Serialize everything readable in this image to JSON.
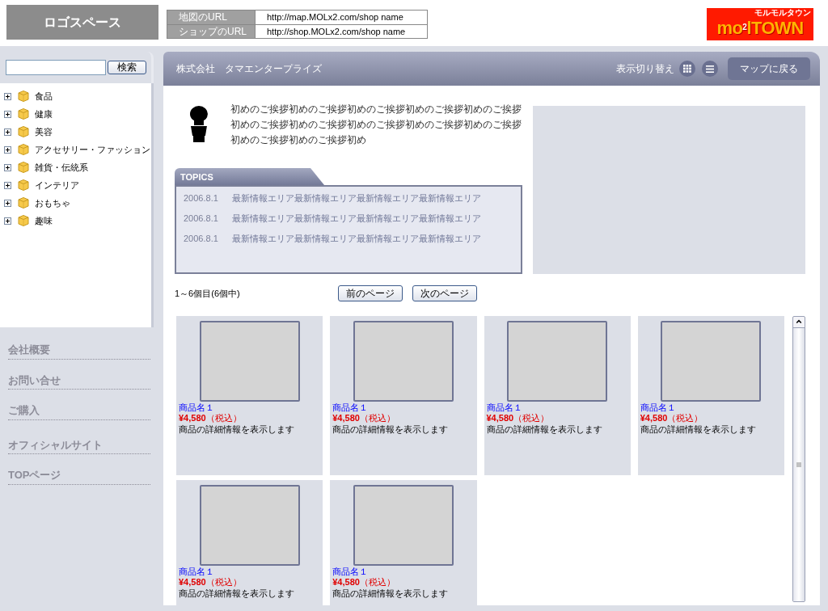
{
  "header": {
    "logo_space": "ロゴスペース",
    "urls": [
      {
        "label": "地図のURL",
        "value": "http://map.MOLx2.com/shop name"
      },
      {
        "label": "ショップのURL",
        "value": "http://shop.MOLx2.com/shop name"
      }
    ],
    "brand": {
      "name_start": "mo",
      "name_mid": "l",
      "name_end": "TOWN",
      "superscript": "2",
      "tagline": "モルモルタウン"
    }
  },
  "sidebar": {
    "search": {
      "button": "検索"
    },
    "categories": [
      {
        "label": "食品",
        "expanded": false
      },
      {
        "label": "健康",
        "expanded": false
      },
      {
        "label": "美容",
        "expanded": false
      },
      {
        "label": "アクセサリー・ファッション",
        "expanded": false
      },
      {
        "label": "雑貨・伝統系",
        "expanded": false
      },
      {
        "label": "インテリア",
        "expanded": false
      },
      {
        "label": "おもちゃ",
        "expanded": false
      },
      {
        "label": "趣味",
        "expanded": false
      }
    ],
    "links": [
      "会社概要",
      "お問い合せ",
      "ご購入",
      "オフィシャルサイト",
      "TOPページ"
    ]
  },
  "main": {
    "company": "株式会社　タマエンタープライズ",
    "view_toggle_label": "表示切り替え",
    "back_button": "マップに戻る",
    "greeting": "初めのご挨拶初めのご挨拶初めのご挨拶初めのご挨拶初めのご挨拶初めのご挨拶初めのご挨拶初めのご挨拶初めのご挨拶初めのご挨拶初めのご挨拶初めのご挨拶初め",
    "topics": {
      "title": "TOPICS",
      "items": [
        {
          "date": "2006.8.1",
          "text": "最新情報エリア最新情報エリア最新情報エリア最新情報エリア"
        },
        {
          "date": "2006.8.1",
          "text": "最新情報エリア最新情報エリア最新情報エリア最新情報エリア"
        },
        {
          "date": "2006.8.1",
          "text": "最新情報エリア最新情報エリア最新情報エリア最新情報エリア"
        }
      ]
    },
    "paging": {
      "count": "1～6個目(6個中)",
      "prev": "前のページ",
      "next": "次のページ"
    },
    "products": [
      {
        "name": "商品名１",
        "price": "¥4,580",
        "tax": "（税込）",
        "description": "商品の詳細情報を表示します"
      },
      {
        "name": "商品名１",
        "price": "¥4,580",
        "tax": "（税込）",
        "description": "商品の詳細情報を表示します"
      },
      {
        "name": "商品名１",
        "price": "¥4,580",
        "tax": "（税込）",
        "description": "商品の詳細情報を表示します"
      },
      {
        "name": "商品名１",
        "price": "¥4,580",
        "tax": "（税込）",
        "description": "商品の詳細情報を表示します"
      },
      {
        "name": "商品名１",
        "price": "¥4,580",
        "tax": "（税込）",
        "description": "商品の詳細情報を表示します"
      },
      {
        "name": "商品名１",
        "price": "¥4,580",
        "tax": "（税込）",
        "description": "商品の詳細情報を表示します"
      }
    ]
  }
}
